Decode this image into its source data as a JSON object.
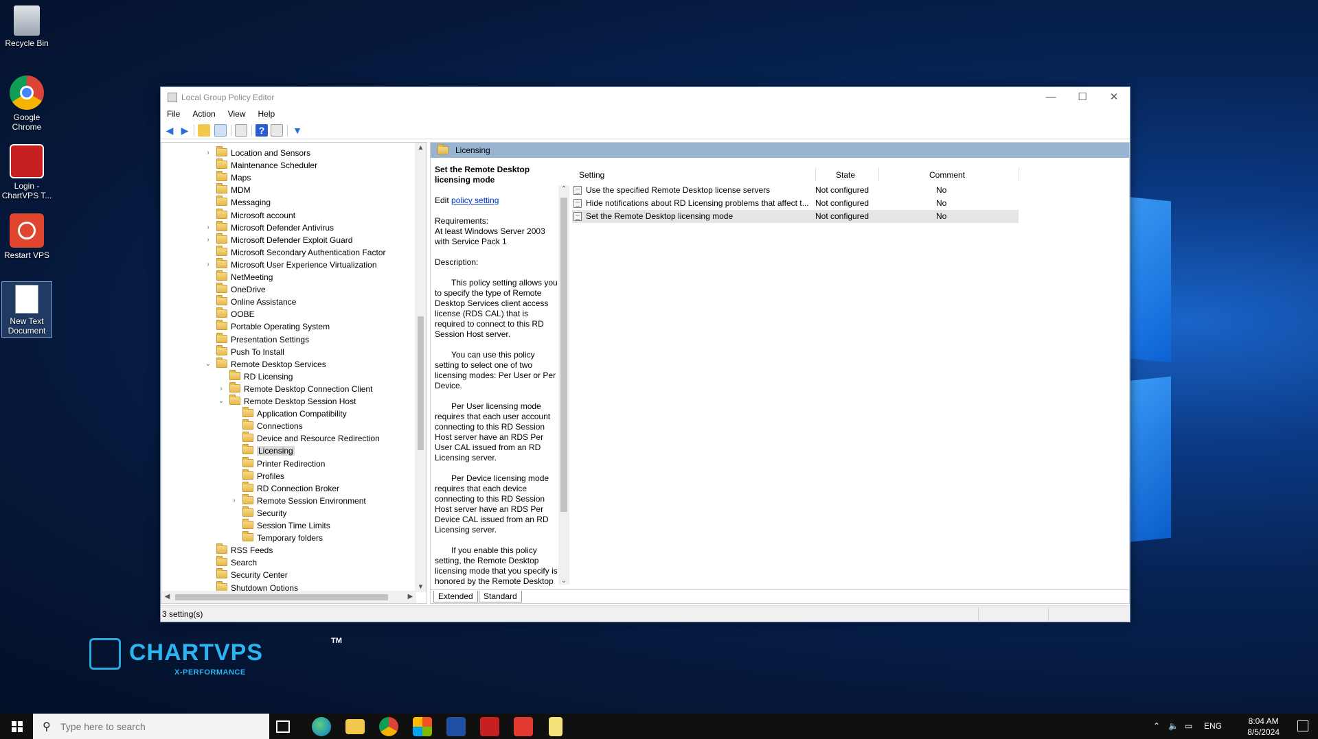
{
  "desktop": {
    "icons": [
      {
        "label": "Recycle Bin",
        "icon": "recycle-bin-icon"
      },
      {
        "label": "Google Chrome",
        "icon": "chrome-icon"
      },
      {
        "label": "Login - ChartVPS T...",
        "icon": "chartvps-login-icon"
      },
      {
        "label": "Restart VPS",
        "icon": "restart-icon"
      },
      {
        "label": "New Text Document",
        "icon": "text-document-icon"
      }
    ],
    "brand": {
      "name": "CHARTVPS",
      "tm": "TM",
      "tagline": "X-PERFORMANCE"
    }
  },
  "window": {
    "title": "Local Group Policy Editor",
    "menu": [
      "File",
      "Action",
      "View",
      "Help"
    ],
    "caption_buttons": {
      "minimize": "—",
      "maximize": "☐",
      "close": "✕"
    }
  },
  "tree": {
    "items": [
      {
        "label": "Location and Sensors",
        "expandable": true,
        "level": 0
      },
      {
        "label": "Maintenance Scheduler",
        "expandable": false,
        "level": 0
      },
      {
        "label": "Maps",
        "expandable": false,
        "level": 0
      },
      {
        "label": "MDM",
        "expandable": false,
        "level": 0
      },
      {
        "label": "Messaging",
        "expandable": false,
        "level": 0
      },
      {
        "label": "Microsoft account",
        "expandable": false,
        "level": 0
      },
      {
        "label": "Microsoft Defender Antivirus",
        "expandable": true,
        "level": 0
      },
      {
        "label": "Microsoft Defender Exploit Guard",
        "expandable": true,
        "level": 0
      },
      {
        "label": "Microsoft Secondary Authentication Factor",
        "expandable": false,
        "level": 0
      },
      {
        "label": "Microsoft User Experience Virtualization",
        "expandable": true,
        "level": 0
      },
      {
        "label": "NetMeeting",
        "expandable": false,
        "level": 0
      },
      {
        "label": "OneDrive",
        "expandable": false,
        "level": 0
      },
      {
        "label": "Online Assistance",
        "expandable": false,
        "level": 0
      },
      {
        "label": "OOBE",
        "expandable": false,
        "level": 0
      },
      {
        "label": "Portable Operating System",
        "expandable": false,
        "level": 0
      },
      {
        "label": "Presentation Settings",
        "expandable": false,
        "level": 0
      },
      {
        "label": "Push To Install",
        "expandable": false,
        "level": 0
      },
      {
        "label": "Remote Desktop Services",
        "expandable": true,
        "expanded": true,
        "level": 0
      },
      {
        "label": "RD Licensing",
        "expandable": false,
        "level": 1
      },
      {
        "label": "Remote Desktop Connection Client",
        "expandable": true,
        "level": 1
      },
      {
        "label": "Remote Desktop Session Host",
        "expandable": true,
        "expanded": true,
        "level": 1
      },
      {
        "label": "Application Compatibility",
        "expandable": false,
        "level": 2
      },
      {
        "label": "Connections",
        "expandable": false,
        "level": 2
      },
      {
        "label": "Device and Resource Redirection",
        "expandable": false,
        "level": 2
      },
      {
        "label": "Licensing",
        "expandable": false,
        "level": 2,
        "selected": true
      },
      {
        "label": "Printer Redirection",
        "expandable": false,
        "level": 2
      },
      {
        "label": "Profiles",
        "expandable": false,
        "level": 2
      },
      {
        "label": "RD Connection Broker",
        "expandable": false,
        "level": 2
      },
      {
        "label": "Remote Session Environment",
        "expandable": true,
        "level": 2
      },
      {
        "label": "Security",
        "expandable": false,
        "level": 2
      },
      {
        "label": "Session Time Limits",
        "expandable": false,
        "level": 2
      },
      {
        "label": "Temporary folders",
        "expandable": false,
        "level": 2
      },
      {
        "label": "RSS Feeds",
        "expandable": false,
        "level": 0
      },
      {
        "label": "Search",
        "expandable": false,
        "level": 0
      },
      {
        "label": "Security Center",
        "expandable": false,
        "level": 0
      },
      {
        "label": "Shutdown Options",
        "expandable": false,
        "level": 0
      }
    ]
  },
  "right": {
    "header": "Licensing",
    "extended": {
      "policy_title": "Set the Remote Desktop licensing mode",
      "edit_prefix": "Edit",
      "edit_link": "policy setting",
      "requirements_label": "Requirements:",
      "requirements_text": "At least Windows Server 2003 with Service Pack 1",
      "description_label": "Description:",
      "paragraphs": [
        "This policy setting allows you to specify the type of Remote Desktop Services client access license (RDS CAL) that is required to connect to this RD Session Host server.",
        "You can use this policy setting to select one of two licensing modes: Per User or Per Device.",
        "Per User licensing mode requires that each user account connecting to this RD Session Host server have an RDS Per User CAL issued from an RD Licensing server.",
        "Per Device licensing mode requires that each device connecting to this RD Session Host server have an RDS Per Device CAL issued from an RD Licensing server.",
        "If you enable this policy setting, the Remote Desktop licensing mode that you specify is honored by the Remote Desktop"
      ]
    },
    "columns": {
      "setting": "Setting",
      "state": "State",
      "comment": "Comment"
    },
    "settings": [
      {
        "name": "Use the specified Remote Desktop license servers",
        "state": "Not configured",
        "comment": "No"
      },
      {
        "name": "Hide notifications about RD Licensing problems that affect t...",
        "state": "Not configured",
        "comment": "No"
      },
      {
        "name": "Set the Remote Desktop licensing mode",
        "state": "Not configured",
        "comment": "No",
        "selected": true
      }
    ],
    "tabs": [
      "Extended",
      "Standard"
    ]
  },
  "status": {
    "text": "3 setting(s)"
  },
  "taskbar": {
    "search_placeholder": "Type here to search",
    "apps": [
      "task-view-icon",
      "edge-icon",
      "file-explorer-icon",
      "chrome-icon",
      "windows-store-icon",
      "powershell-icon",
      "chartvps-icon",
      "anydesk-icon",
      "notepad-icon"
    ],
    "tray": {
      "language": "ENG",
      "time": "8:04 AM",
      "date": "8/5/2024"
    }
  }
}
